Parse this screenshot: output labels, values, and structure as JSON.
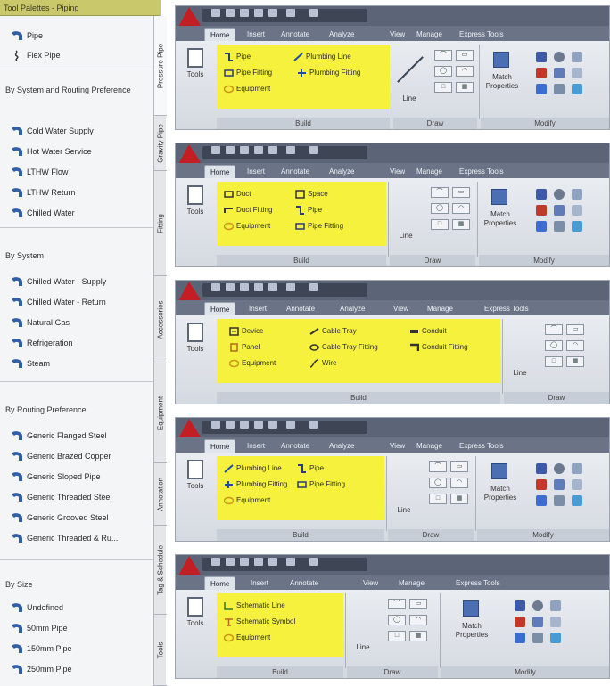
{
  "palette": {
    "title": "Tool Palettes - Piping",
    "top_items": [
      {
        "label": "Pipe"
      },
      {
        "label": "Flex Pipe"
      }
    ],
    "sections": [
      {
        "heading": "By System and Routing Preference",
        "items": [
          "Cold Water Supply",
          "Hot Water Service",
          "LTHW Flow",
          "LTHW Return",
          "Chilled Water"
        ]
      },
      {
        "heading": "By System",
        "items": [
          "Chilled Water - Supply",
          "Chilled Water - Return",
          "Natural Gas",
          "Refrigeration",
          "Steam"
        ]
      },
      {
        "heading": "By Routing Preference",
        "items": [
          "Generic Flanged Steel",
          "Generic Brazed Copper",
          "Generic Sloped Pipe",
          "Generic Threaded Steel",
          "Generic Grooved Steel",
          "Generic Threaded & Ru..."
        ]
      },
      {
        "heading": "By Size",
        "items": [
          "Undefined",
          "50mm Pipe",
          "150mm Pipe",
          "250mm Pipe"
        ]
      }
    ],
    "vertical_tabs": [
      "Pressure Pipe",
      "Gravity Pipe",
      "Fitting",
      "Accessories",
      "Equipment",
      "Annotation",
      "Tag & Schedule",
      "Tools"
    ]
  },
  "ribbons": [
    {
      "tabs": [
        "Home",
        "Insert",
        "Annotate",
        "Analyze",
        "View",
        "Manage",
        "Express Tools"
      ],
      "build_items": [
        "Pipe",
        "Plumbing Line",
        "Pipe Fitting",
        "Plumbing Fitting",
        "Equipment"
      ],
      "panels": {
        "tools": "Tools",
        "build": "Build",
        "draw": "Draw",
        "modify": "Modify",
        "line": "Line",
        "match": "Match",
        "properties": "Properties"
      }
    },
    {
      "tabs": [
        "Home",
        "Insert",
        "Annotate",
        "Analyze",
        "View",
        "Manage",
        "Express Tools"
      ],
      "build_items": [
        "Duct",
        "Space",
        "Duct Fitting",
        "Pipe",
        "Equipment",
        "Pipe Fitting"
      ],
      "panels": {
        "tools": "Tools",
        "build": "Build",
        "draw": "Draw",
        "modify": "Modify",
        "line": "Line",
        "match": "Match",
        "properties": "Properties"
      }
    },
    {
      "tabs": [
        "Home",
        "Insert",
        "Annotate",
        "Analyze",
        "View",
        "Manage",
        "Express Tools"
      ],
      "build_items": [
        "Device",
        "Cable Tray",
        "Conduit",
        "Panel",
        "Cable Tray Fitting",
        "Conduit Fitting",
        "Equipment",
        "Wire"
      ],
      "panels": {
        "tools": "Tools",
        "build": "Build",
        "draw": "Draw",
        "line": "Line"
      }
    },
    {
      "tabs": [
        "Home",
        "Insert",
        "Annotate",
        "Analyze",
        "View",
        "Manage",
        "Express Tools"
      ],
      "build_items": [
        "Plumbing Line",
        "Pipe",
        "Plumbing Fitting",
        "Pipe Fitting",
        "Equipment"
      ],
      "panels": {
        "tools": "Tools",
        "build": "Build",
        "draw": "Draw",
        "modify": "Modify",
        "line": "Line",
        "match": "Match",
        "properties": "Properties"
      }
    },
    {
      "tabs": [
        "Home",
        "Insert",
        "Annotate",
        "View",
        "Manage",
        "Express Tools"
      ],
      "build_items": [
        "Schematic Line",
        "Schematic Symbol",
        "Equipment"
      ],
      "panels": {
        "tools": "Tools",
        "build": "Build",
        "draw": "Draw",
        "modify": "Modify",
        "line": "Line",
        "match": "Match",
        "properties": "Properties"
      }
    }
  ],
  "colors": {
    "highlight": "#f6f13c",
    "pipe_icon": "#2f5fa8",
    "app_logo": "#c41e25",
    "palette_title": "#c9c86a"
  }
}
